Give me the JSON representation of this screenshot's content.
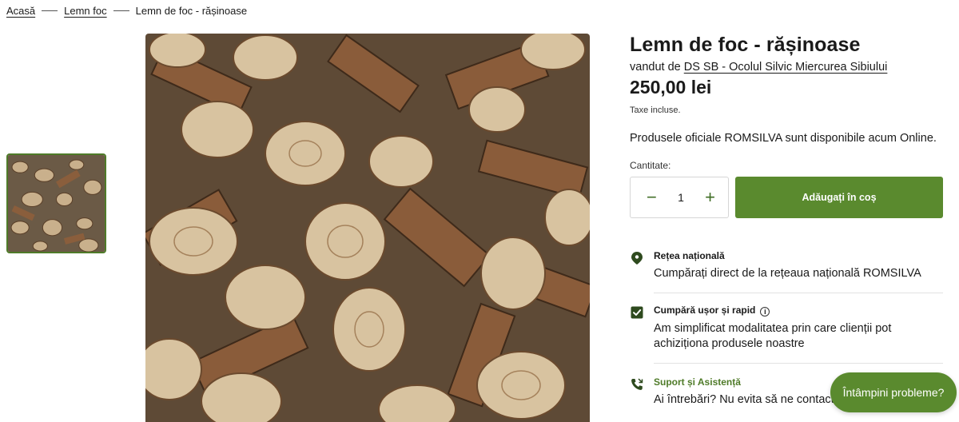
{
  "breadcrumb": {
    "home": "Acasă",
    "category": "Lemn foc",
    "current": "Lemn de foc - rășinoase"
  },
  "product": {
    "title": "Lemn de foc - rășinoase",
    "vendor_prefix": "vandut de",
    "vendor_name": "DS SB - Ocolul Silvic Miercurea Sibiului",
    "price": "250,00 lei",
    "tax_note": "Taxe incluse.",
    "description": "Produsele oficiale ROMSILVA sunt disponibile acum Online.",
    "quantity_label": "Cantitate:",
    "quantity_value": "1",
    "minus_symbol": "−",
    "plus_symbol": "+",
    "add_to_cart": "Adăugați în coș"
  },
  "features": [
    {
      "icon": "map-pin-icon",
      "title": "Rețea națională",
      "text": "Cumpărați direct de la rețeaua națională ROMSILVA"
    },
    {
      "icon": "checkbox-icon",
      "title": "Cumpără ușor și rapid",
      "text": "Am simplificat modalitatea prin care clienții pot achiziționa produsele noastre"
    },
    {
      "icon": "phone-icon",
      "title": "Suport și Asistență",
      "text": "Ai întrebări? Nu evita să ne contactezi"
    }
  ],
  "help_button": "Întâmpini probleme?",
  "colors": {
    "accent": "#5a8a2e",
    "accent_dark": "#3f6d24",
    "text": "#1a1a1a"
  }
}
